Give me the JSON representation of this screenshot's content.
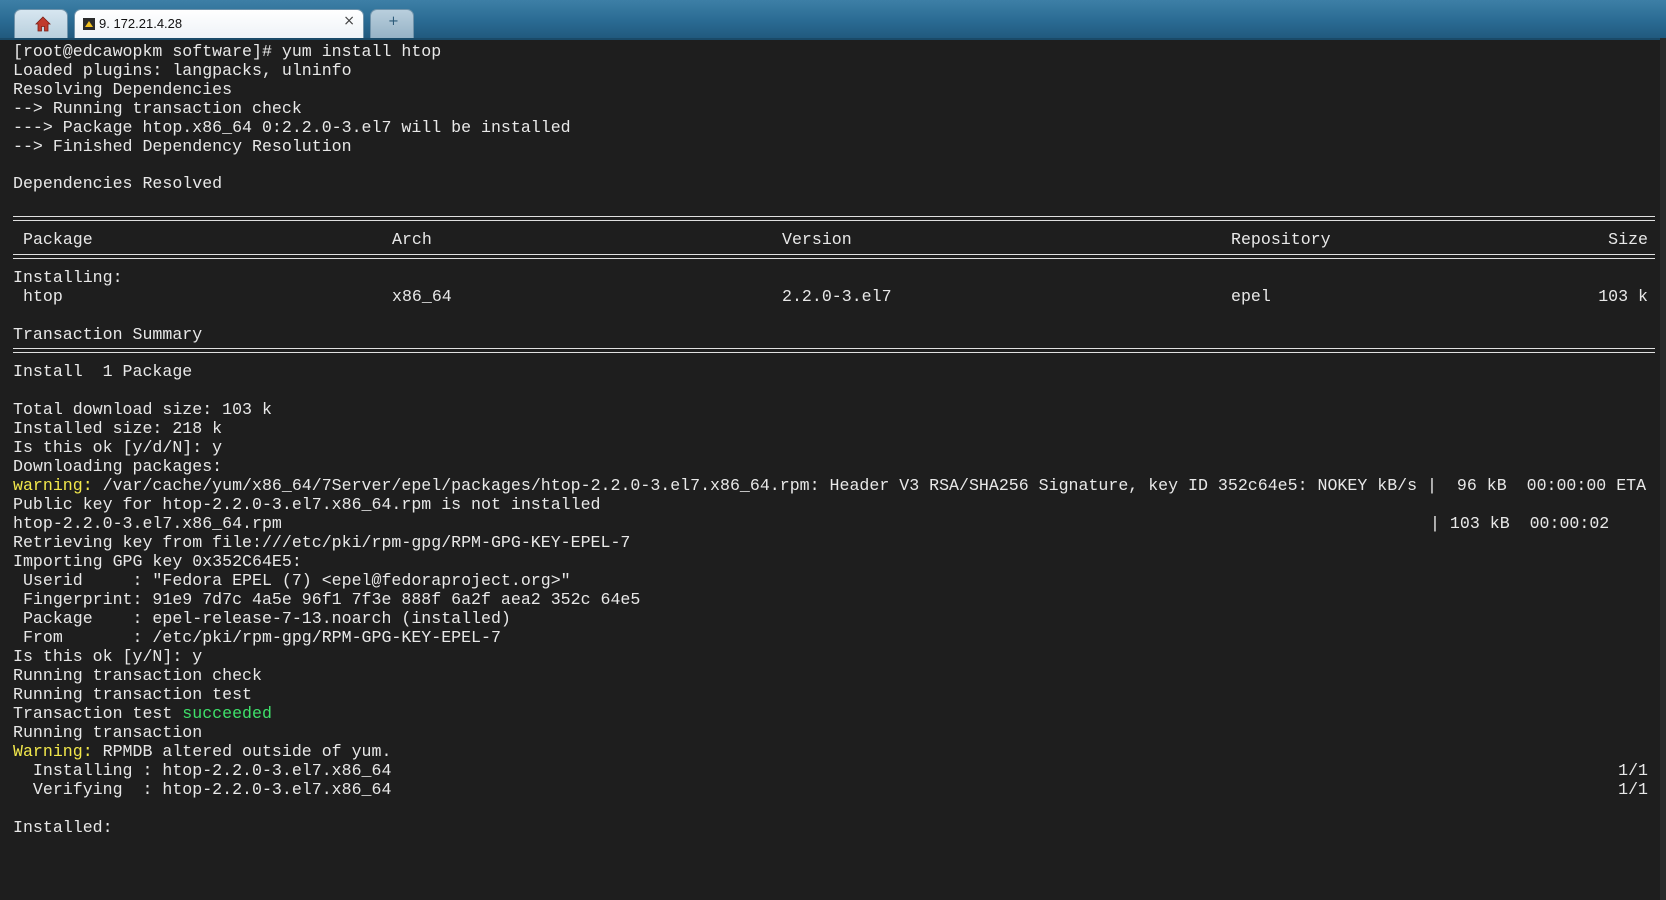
{
  "tabs": [
    {
      "title": "",
      "icon": "home-icon"
    },
    {
      "title": "9. 172.21.4.28",
      "icon": "session-icon",
      "close": "×"
    },
    {
      "title": "+",
      "icon": "new-tab-icon"
    }
  ],
  "terminal": {
    "block1": [
      "[root@edcawopkm software]# yum install htop",
      "Loaded plugins: langpacks, ulninfo",
      "Resolving Dependencies",
      "--> Running transaction check",
      "---> Package htop.x86_64 0:2.2.0-3.el7 will be installed",
      "--> Finished Dependency Resolution"
    ],
    "deps_resolved": "Dependencies Resolved",
    "table_header": {
      "package": "Package",
      "arch": "Arch",
      "version": "Version",
      "repository": "Repository",
      "size": "Size"
    },
    "installing_label": "Installing:",
    "row": {
      "package": "htop",
      "arch": "x86_64",
      "version": "2.2.0-3.el7",
      "repository": "epel",
      "size": "103 k"
    },
    "transaction_summary": "Transaction Summary",
    "install_count": "Install  1 Package",
    "block2": [
      "Total download size: 103 k",
      "Installed size: 218 k",
      "Is this ok [y/d/N]: y",
      "Downloading packages:"
    ],
    "warning_label": "warning:",
    "warning_text": " /var/cache/yum/x86_64/7Server/epel/packages/htop-2.2.0-3.el7.x86_64.rpm: Header V3 RSA/SHA256 Signature, key ID 352c64e5: NOKEY kB/s |  96 kB  00:00:00 ETA",
    "pubkey": "Public key for htop-2.2.0-3.el7.x86_64.rpm is not installed",
    "rpm_file": "htop-2.2.0-3.el7.x86_64.rpm",
    "rpm_progress": "| 103 kB  00:00:02",
    "block3": [
      "Retrieving key from file:///etc/pki/rpm-gpg/RPM-GPG-KEY-EPEL-7",
      "Importing GPG key 0x352C64E5:",
      " Userid     : \"Fedora EPEL (7) <epel@fedoraproject.org>\"",
      " Fingerprint: 91e9 7d7c 4a5e 96f1 7f3e 888f 6a2f aea2 352c 64e5",
      " Package    : epel-release-7-13.noarch (installed)",
      " From       : /etc/pki/rpm-gpg/RPM-GPG-KEY-EPEL-7",
      "Is this ok [y/N]: y",
      "Running transaction check",
      "Running transaction test"
    ],
    "test_prefix": "Transaction test ",
    "test_result": "succeeded",
    "running_tx": "Running transaction",
    "warning2_label": "Warning:",
    "warning2_text": " RPMDB altered outside of yum.",
    "installing_step": "  Installing : htop-2.2.0-3.el7.x86_64",
    "installing_count": "1/1",
    "verifying_step": "  Verifying  : htop-2.2.0-3.el7.x86_64",
    "verifying_count": "1/1",
    "installed_label": "Installed:"
  },
  "colors": {
    "background": "#1e1e1e",
    "text": "#e8e8e8",
    "warning": "#f2e84b",
    "success": "#3fe06a",
    "tabbar": "#2a6b93"
  }
}
